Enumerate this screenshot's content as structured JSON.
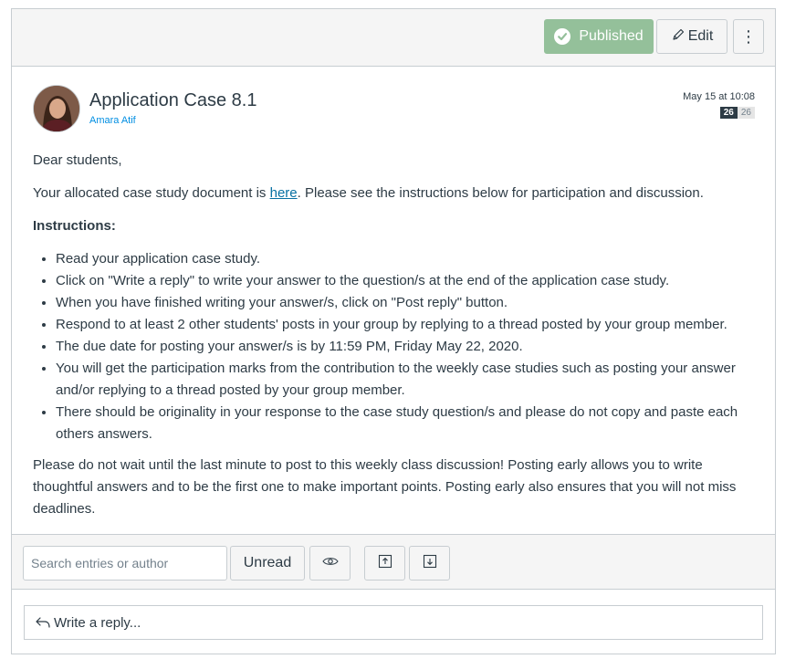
{
  "toolbar": {
    "published_label": "Published",
    "edit_label": "Edit",
    "more_label": "⋮"
  },
  "post": {
    "title": "Application Case 8.1",
    "author": "Amara Atif",
    "date": "May 15 at 10:08",
    "unread_count": "26",
    "total_count": "26"
  },
  "body": {
    "greeting": "Dear students,",
    "intro_before_link": "Your allocated case study document is ",
    "link_text": "here",
    "intro_after_link": ". Please see the instructions below for participation and discussion.",
    "instructions_heading": "Instructions:",
    "instructions": [
      "Read your application case study.",
      "Click on \"Write a reply\" to write your answer to the question/s at the end of the application case study.",
      "When you have finished writing your answer/s, click on \"Post reply\" button.",
      "Respond to at least 2 other students' posts in your group by replying to a thread posted by your group member.",
      "The due date for posting your answer/s is by 11:59 PM, Friday May 22, 2020.",
      "You will get the participation marks from the contribution to the weekly case studies such as posting your answer and/or replying to a thread posted by your group member.",
      "There should be originality in your response to the case study question/s and please do not copy and paste each others answers."
    ],
    "closing": "Please do not wait until the last minute to post to this weekly class discussion! Posting early allows you to write thoughtful answers and to be the first one to make important points. Posting early also ensures that you will not miss deadlines."
  },
  "filters": {
    "search_placeholder": "Search entries or author",
    "unread_label": "Unread"
  },
  "reply": {
    "label": "Write a reply..."
  },
  "colors": {
    "published_green": "#94c09a",
    "link_blue": "#0770a3",
    "author_blue": "#008ee2",
    "badge_dark": "#2d3b45"
  },
  "icons": {
    "published": "check-circle-icon",
    "edit": "pencil-icon",
    "more": "kebab-icon",
    "eye": "eye-icon",
    "expand": "collapse-up-icon",
    "collapse": "expand-down-icon",
    "reply": "reply-arrow-icon"
  }
}
